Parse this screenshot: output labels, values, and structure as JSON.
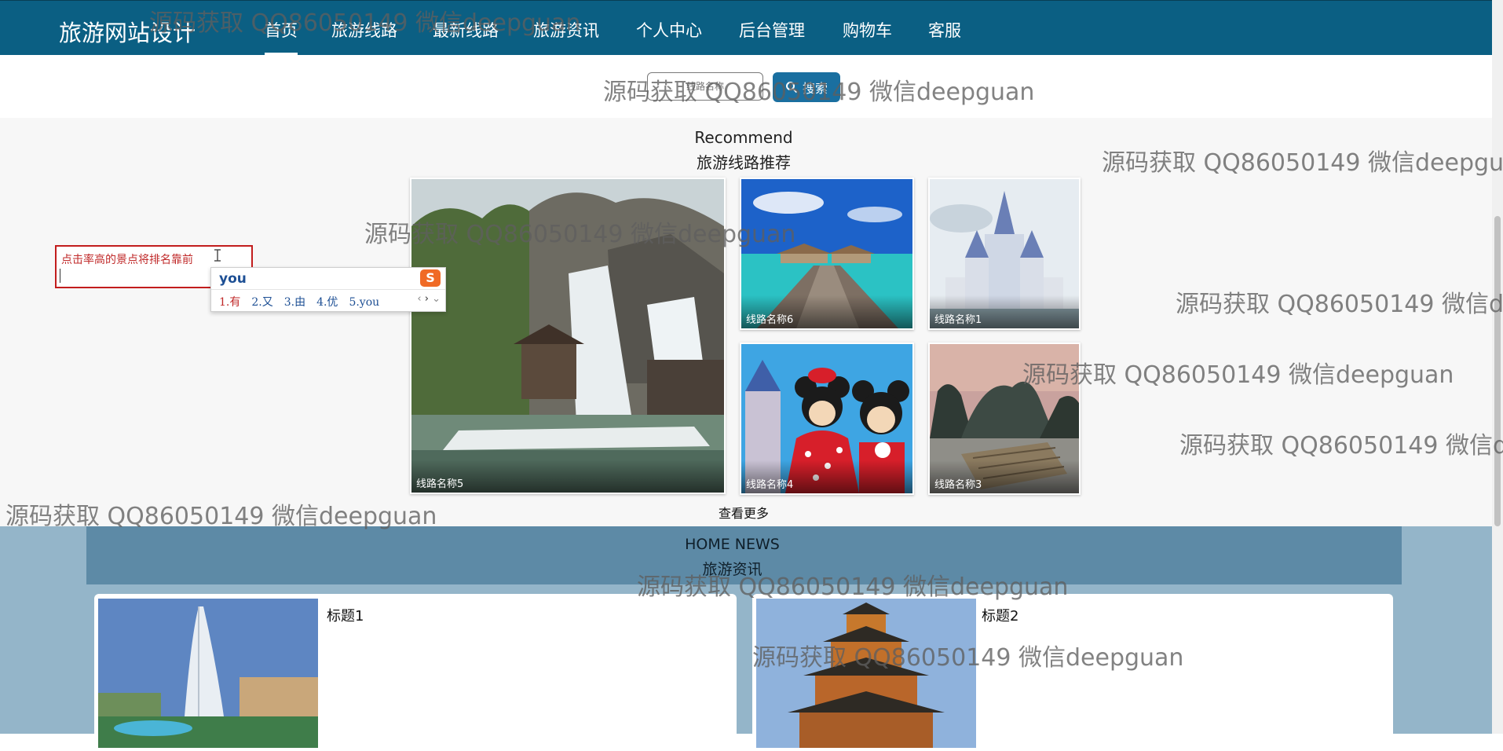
{
  "nav": {
    "brand": "旅游网站设计",
    "items": [
      {
        "label": "首页"
      },
      {
        "label": "旅游线路"
      },
      {
        "label": "最新线路"
      },
      {
        "label": "旅游资讯"
      },
      {
        "label": "个人中心"
      },
      {
        "label": "后台管理"
      },
      {
        "label": "购物车"
      },
      {
        "label": "客服"
      }
    ]
  },
  "search": {
    "placeholder": "线路名称",
    "button_label": "搜索"
  },
  "recommend": {
    "title_en": "Recommend",
    "title_cn": "旅游线路推荐",
    "routes": [
      {
        "name": "线路名称5"
      },
      {
        "name": "线路名称6"
      },
      {
        "name": "线路名称1"
      },
      {
        "name": "线路名称4"
      },
      {
        "name": "线路名称3"
      }
    ],
    "more_label": "查看更多"
  },
  "annotation": {
    "text": "点击率高的景点将排名靠前"
  },
  "ime": {
    "input": "you",
    "candidates": [
      "1.有",
      "2.又",
      "3.由",
      "4.优",
      "5.you"
    ]
  },
  "news": {
    "title_en": "HOME NEWS",
    "title_cn": "旅游资讯",
    "items": [
      {
        "title": "标题1"
      },
      {
        "title": "标题2"
      }
    ]
  },
  "watermark": {
    "text": "源码获取 QQ86050149 微信deepguan"
  },
  "colors": {
    "nav_bg": "#0b5f83",
    "search_button": "#1a6fa0",
    "annotation_border": "#c21d1d",
    "news_band": "#94b5c9",
    "news_header": "#5d8aa6"
  }
}
